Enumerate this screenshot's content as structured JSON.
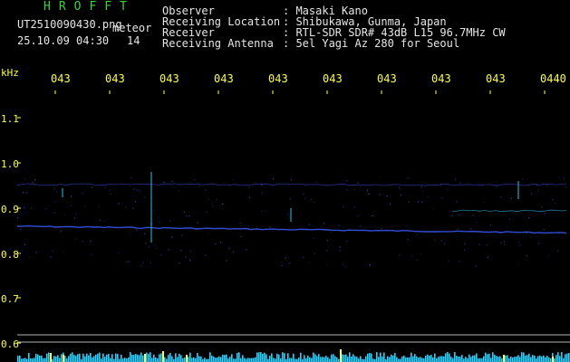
{
  "header": {
    "logo": "HROFFT",
    "filename": "UT2510090430.png",
    "mode": "meteor",
    "datetime": "25.10.09 04:30",
    "count": "14",
    "fields": [
      {
        "label": "Observer",
        "value": ": Masaki Kano"
      },
      {
        "label": "Receiving Location",
        "value": ": Shibukawa, Gunma, Japan"
      },
      {
        "label": "Receiver",
        "value": ": RTL-SDR SDR# 43dB L15 96.7MHz CW"
      },
      {
        "label": "Receiving Antenna",
        "value": ": 5el Yagi Az 280 for Seoul"
      }
    ]
  },
  "axis": {
    "y_unit": "kHz",
    "y_ticks": [
      "1.1",
      "1.0",
      "0.9",
      "0.8",
      "0.7",
      "0.6"
    ],
    "x_ticks": [
      "043",
      "043",
      "043",
      "043",
      "043",
      "043",
      "043",
      "043",
      "043",
      "0440"
    ]
  },
  "colors": {
    "background": "#000000",
    "text_yellow": "#ffff46",
    "text_green": "#3cd23c",
    "text_white": "#e6e6e6",
    "trace_blue": "#3c5aff",
    "trace_cyan": "#32c8ff",
    "meter_yellow": "#ffff46",
    "meter_cyan": "#28d2ff"
  }
}
